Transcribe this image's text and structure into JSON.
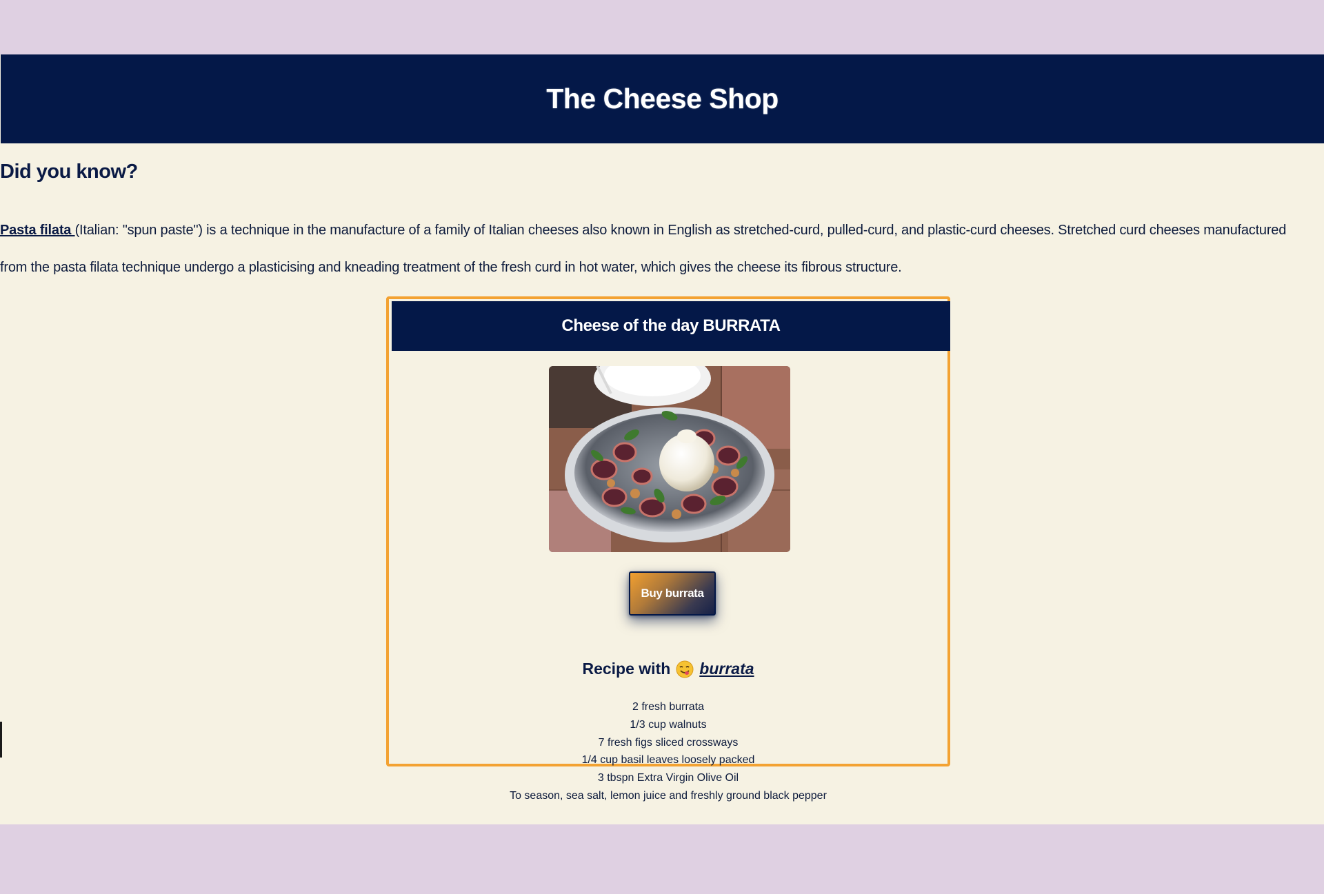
{
  "header": {
    "title": "The Cheese Shop"
  },
  "fact": {
    "heading": "Did you know?",
    "link_text": "Pasta filata ",
    "line1_rest": "(Italian: \"spun paste\") is a technique in the manufacture of a family of Italian cheeses also known in English as stretched-curd, pulled-curd, and plastic-curd cheeses. Stretched curd cheeses manufactured",
    "line2": "from the pasta filata technique undergo a plasticising and kneading treatment of the fresh curd in hot water, which gives the cheese its fibrous structure."
  },
  "card": {
    "title": "Cheese of the day BURRATA",
    "buy_label": "Buy burrata",
    "recipe_prefix": "Recipe with",
    "recipe_link": "burrata",
    "ingredients": [
      "2 fresh burrata",
      "1/3 cup walnuts",
      "7 fresh figs sliced crossways",
      "1/4 cup basil leaves loosely packed",
      "3 tbspn Extra Virgin Olive Oil",
      "To season, sea salt, lemon juice and freshly ground black pepper"
    ]
  },
  "colors": {
    "navy": "#041848",
    "accent_orange": "#f3a232",
    "page_bg": "#f6f2e3",
    "outer_bg": "#dfd0e2"
  },
  "icons": {
    "recipe_emoji": "face-savoring-food-icon"
  }
}
